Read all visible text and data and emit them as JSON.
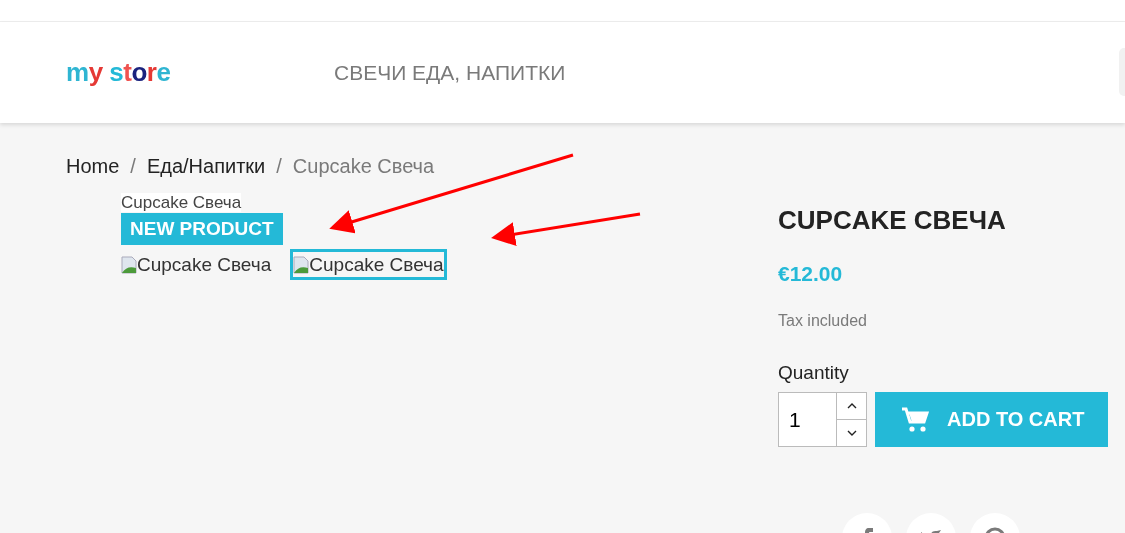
{
  "header": {
    "logo": "my store",
    "menu": [
      {
        "label": "СВЕЧИ ЕДА, НАПИТКИ"
      }
    ]
  },
  "breadcrumb_separator": "/",
  "breadcrumb": [
    {
      "label": "Home",
      "current": false
    },
    {
      "label": "Еда/Напитки",
      "current": false
    },
    {
      "label": "Cupcake Свеча",
      "current": true
    }
  ],
  "gallery": {
    "cover_alt": "Cupcake Свеча",
    "badge": "NEW PRODUCT",
    "thumbnails": [
      {
        "alt": "Cupcake Свеча",
        "selected": false
      },
      {
        "alt": "Cupcake Свеча",
        "selected": true
      }
    ]
  },
  "product": {
    "title": "CUPCAKE СВЕЧА",
    "price": "€12.00",
    "tax_note": "Tax included",
    "quantity_label": "Quantity",
    "quantity": "1",
    "add_button": "ADD TO CART"
  }
}
